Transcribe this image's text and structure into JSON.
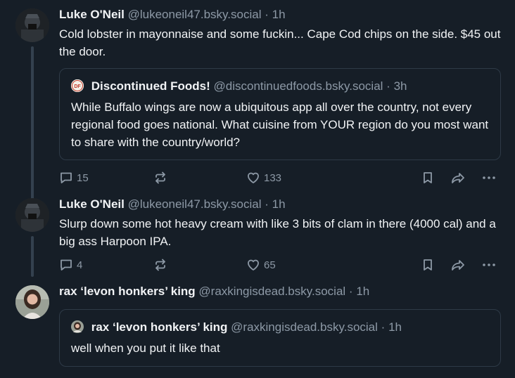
{
  "posts": [
    {
      "name": "Luke O'Neil",
      "handle": "@lukeoneil47.bsky.social",
      "sep": "·",
      "time": "1h",
      "text": "Cold lobster in mayonnaise and some fuckin... Cape Cod chips on the side. $45 out the door.",
      "quote": {
        "avatar_text": "DF",
        "name": "Discontinued Foods!",
        "handle": "@discontinuedfoods.bsky.social",
        "sep": "·",
        "time": "3h",
        "text": "While Buffalo wings are now a ubiquitous app all over the country, not every regional food goes national. What cuisine from YOUR region do you most want to share with the country/world?"
      },
      "replies": "15",
      "likes": "133"
    },
    {
      "name": "Luke O'Neil",
      "handle": "@lukeoneil47.bsky.social",
      "sep": "·",
      "time": "1h",
      "text": "Slurp down some hot heavy cream with like 3 bits of clam in there (4000 cal) and a big ass Harpoon IPA.",
      "replies": "4",
      "likes": "65"
    },
    {
      "name": "rax ‘levon honkers’ king",
      "handle": "@raxkingisdead.bsky.social",
      "sep": "·",
      "time": "1h",
      "quote": {
        "name": "rax ‘levon honkers’ king",
        "handle": "@raxkingisdead.bsky.social",
        "sep": "·",
        "time": "1h",
        "text": "well when you put it like that"
      }
    }
  ],
  "colors": {
    "background": "#161e27",
    "text": "#f1f3f5",
    "muted": "#8d99a6",
    "border": "#2e3a47",
    "thread_line": "#34414f"
  },
  "icons": [
    "reply-icon",
    "repost-icon",
    "like-icon",
    "bookmark-icon",
    "share-icon",
    "more-icon"
  ]
}
